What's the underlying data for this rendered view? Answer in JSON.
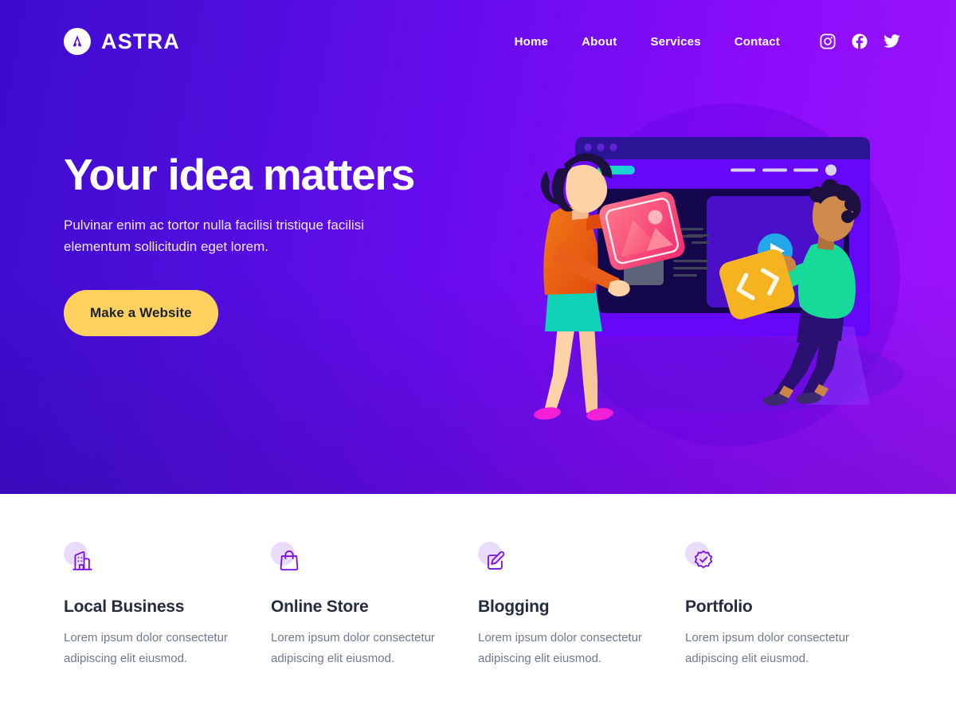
{
  "brand": {
    "name": "ASTRA",
    "logo_icon": "astra-logo-icon",
    "logo_bg": "#ffffff",
    "logo_mark_color": "#5a0ae0"
  },
  "nav": {
    "links": [
      {
        "label": "Home"
      },
      {
        "label": "About"
      },
      {
        "label": "Services"
      },
      {
        "label": "Contact"
      }
    ],
    "socials": [
      {
        "name": "instagram-icon"
      },
      {
        "name": "facebook-icon"
      },
      {
        "name": "twitter-icon"
      }
    ]
  },
  "hero": {
    "title": "Your idea matters",
    "subtitle": "Pulvinar enim ac tortor nulla facilisi tristique facilisi elementum sollicitudin eget lorem.",
    "cta_label": "Make a Website",
    "cta_bg": "#ffd260",
    "cta_text_color": "#1c2230",
    "gradient_start": "#3d0ad0",
    "gradient_end": "#9e14fc",
    "illustration": {
      "name": "team-building-website-illustration",
      "browser_titlebar_color": "#2b1596",
      "browser_body_color": "#6608f7",
      "content_panel_color": "#14064a",
      "accent_pill_color": "#17e0b0",
      "play_button_color": "#22a8e8",
      "image_card_color": "#f5336d",
      "code_card_color": "#f5b321",
      "woman_top_color": "#e8601a",
      "woman_skirt_color": "#10d2b6",
      "man_top_color": "#17d99a"
    }
  },
  "features": [
    {
      "icon": "building-icon",
      "title": "Local Business",
      "desc": "Lorem ipsum dolor consectetur adipiscing elit eiusmod."
    },
    {
      "icon": "shopping-bag-icon",
      "title": "Online Store",
      "desc": "Lorem ipsum dolor consectetur adipiscing elit eiusmod."
    },
    {
      "icon": "edit-square-icon",
      "title": "Blogging",
      "desc": "Lorem ipsum dolor consectetur adipiscing elit eiusmod."
    },
    {
      "icon": "verified-badge-icon",
      "title": "Portfolio",
      "desc": "Lorem ipsum dolor consectetur adipiscing elit eiusmod."
    }
  ],
  "theme": {
    "icon_stroke": "#7a0fe0",
    "icon_bg": "#e9dcfb",
    "heading_color": "#242c3e",
    "body_color": "#6f7a8e"
  }
}
